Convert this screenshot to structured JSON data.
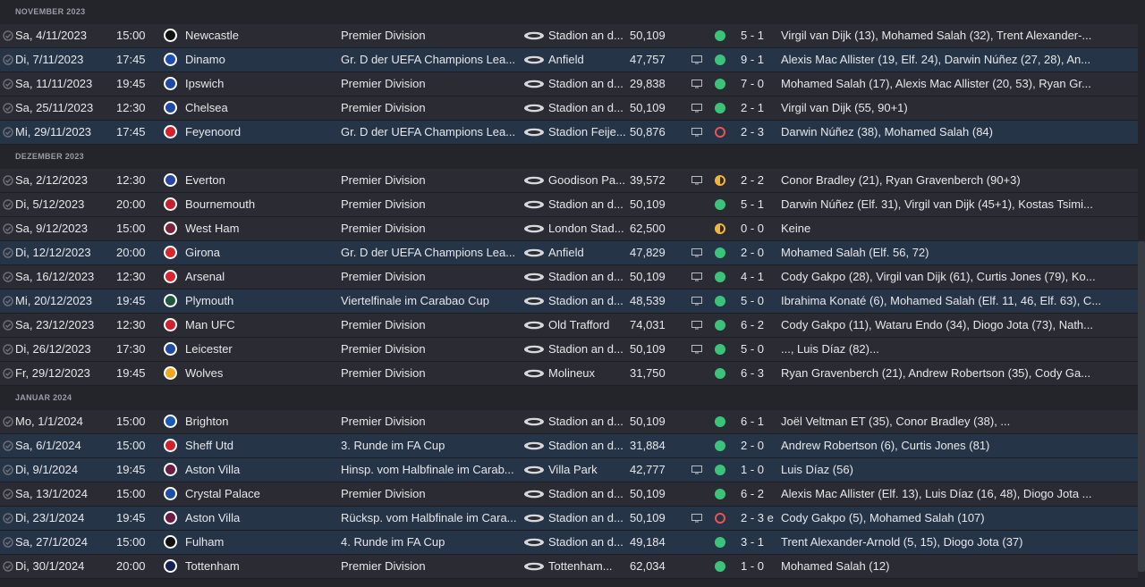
{
  "sections": [
    {
      "title": "NOVEMBER 2023",
      "matches": [
        {
          "date": "Sa, 4/11/2023",
          "time": "15:00",
          "opponent": "Newcastle",
          "crest": "newcastle-crest-icon",
          "crest_color": "#111111",
          "competition": "Premier Division",
          "stadium": "Stadion an d...",
          "attendance": "50,109",
          "tv": false,
          "result": "win",
          "score": "5 - 1",
          "scorers": "Virgil van Dijk (13), Mohamed Salah (32), Trent Alexander-...",
          "euro": false
        },
        {
          "date": "Di, 7/11/2023",
          "time": "17:45",
          "opponent": "Dinamo",
          "crest": "dinamo-crest-icon",
          "crest_color": "#1b4fb5",
          "competition": "Gr. D der UEFA Champions Lea...",
          "stadium": "Anfield",
          "attendance": "47,757",
          "tv": true,
          "result": "win",
          "score": "9 - 1",
          "scorers": "Alexis Mac Allister (19, Elf. 24), Darwin Núñez (27, 28), An...",
          "euro": true
        },
        {
          "date": "Sa, 11/11/2023",
          "time": "19:45",
          "opponent": "Ipswich",
          "crest": "ipswich-crest-icon",
          "crest_color": "#1c4aa6",
          "competition": "Premier Division",
          "stadium": "Stadion an d...",
          "attendance": "29,838",
          "tv": true,
          "result": "win",
          "score": "7 - 0",
          "scorers": "Mohamed Salah (17), Alexis Mac Allister (20, 53), Ryan Gr...",
          "euro": false
        },
        {
          "date": "Sa, 25/11/2023",
          "time": "12:30",
          "opponent": "Chelsea",
          "crest": "chelsea-crest-icon",
          "crest_color": "#1f4aa8",
          "competition": "Premier Division",
          "stadium": "Stadion an d...",
          "attendance": "50,109",
          "tv": true,
          "result": "win",
          "score": "2 - 1",
          "scorers": "Virgil van Dijk (55, 90+1)",
          "euro": false
        },
        {
          "date": "Mi, 29/11/2023",
          "time": "17:45",
          "opponent": "Feyenoord",
          "crest": "feyenoord-crest-icon",
          "crest_color": "#d6202a",
          "competition": "Gr. D der UEFA Champions Lea...",
          "stadium": "Stadion Feije...",
          "attendance": "50,876",
          "tv": true,
          "result": "loss",
          "score": "2 - 3",
          "scorers": "Darwin Núñez (38), Mohamed Salah (84)",
          "euro": true
        }
      ]
    },
    {
      "title": "DEZEMBER 2023",
      "matches": [
        {
          "date": "Sa, 2/12/2023",
          "time": "12:30",
          "opponent": "Everton",
          "crest": "everton-crest-icon",
          "crest_color": "#2746a8",
          "competition": "Premier Division",
          "stadium": "Goodison Pa...",
          "attendance": "39,572",
          "tv": true,
          "result": "draw",
          "score": "2 - 2",
          "scorers": "Conor Bradley (21), Ryan Gravenberch (90+3)",
          "euro": false
        },
        {
          "date": "Di, 5/12/2023",
          "time": "20:00",
          "opponent": "Bournemouth",
          "crest": "bournemouth-crest-icon",
          "crest_color": "#c8202c",
          "competition": "Premier Division",
          "stadium": "Stadion an d...",
          "attendance": "50,109",
          "tv": false,
          "result": "win",
          "score": "5 - 1",
          "scorers": "Darwin Núñez (Elf. 31), Virgil van Dijk (45+1), Kostas Tsimi...",
          "euro": false
        },
        {
          "date": "Sa, 9/12/2023",
          "time": "15:00",
          "opponent": "West Ham",
          "crest": "westham-crest-icon",
          "crest_color": "#7a263a",
          "competition": "Premier Division",
          "stadium": "London Stad...",
          "attendance": "62,500",
          "tv": false,
          "result": "draw",
          "score": "0 - 0",
          "scorers": "Keine",
          "euro": false
        },
        {
          "date": "Di, 12/12/2023",
          "time": "20:00",
          "opponent": "Girona",
          "crest": "girona-crest-icon",
          "crest_color": "#d42a2a",
          "competition": "Gr. D der UEFA Champions Lea...",
          "stadium": "Anfield",
          "attendance": "47,829",
          "tv": true,
          "result": "win",
          "score": "2 - 0",
          "scorers": "Mohamed Salah (Elf. 56, 72)",
          "euro": true
        },
        {
          "date": "Sa, 16/12/2023",
          "time": "12:30",
          "opponent": "Arsenal",
          "crest": "arsenal-crest-icon",
          "crest_color": "#d8262c",
          "competition": "Premier Division",
          "stadium": "Stadion an d...",
          "attendance": "50,109",
          "tv": true,
          "result": "win",
          "score": "4 - 1",
          "scorers": "Cody Gakpo (28), Virgil van Dijk (61), Curtis Jones (79), Ko...",
          "euro": false
        },
        {
          "date": "Mi, 20/12/2023",
          "time": "19:45",
          "opponent": "Plymouth",
          "crest": "plymouth-crest-icon",
          "crest_color": "#1e5b3e",
          "competition": "Viertelfinale im Carabao Cup",
          "stadium": "Stadion an d...",
          "attendance": "48,539",
          "tv": true,
          "result": "win",
          "score": "5 - 0",
          "scorers": "Ibrahima Konaté (6), Mohamed Salah (Elf. 11, 46, Elf. 63), C...",
          "euro": true
        },
        {
          "date": "Sa, 23/12/2023",
          "time": "12:30",
          "opponent": "Man UFC",
          "crest": "manutd-crest-icon",
          "crest_color": "#d4202a",
          "competition": "Premier Division",
          "stadium": "Old Trafford",
          "attendance": "74,031",
          "tv": true,
          "result": "win",
          "score": "6 - 2",
          "scorers": "Cody Gakpo (11), Wataru Endo (34), Diogo Jota (73), Nath...",
          "euro": false
        },
        {
          "date": "Di, 26/12/2023",
          "time": "17:30",
          "opponent": "Leicester",
          "crest": "leicester-crest-icon",
          "crest_color": "#1f4ba4",
          "competition": "Premier Division",
          "stadium": "Stadion an d...",
          "attendance": "50,109",
          "tv": true,
          "result": "win",
          "score": "5 - 0",
          "scorers": "..., Luis Díaz (82)...",
          "euro": false
        },
        {
          "date": "Fr, 29/12/2023",
          "time": "19:45",
          "opponent": "Wolves",
          "crest": "wolves-crest-icon",
          "crest_color": "#f2a81c",
          "competition": "Premier Division",
          "stadium": "Molineux",
          "attendance": "31,750",
          "tv": false,
          "result": "win",
          "score": "6 - 3",
          "scorers": "Ryan Gravenberch (21), Andrew Robertson (35), Cody Ga...",
          "euro": false
        }
      ]
    },
    {
      "title": "JANUAR 2024",
      "matches": [
        {
          "date": "Mo, 1/1/2024",
          "time": "15:00",
          "opponent": "Brighton",
          "crest": "brighton-crest-icon",
          "crest_color": "#1a5bb5",
          "competition": "Premier Division",
          "stadium": "Stadion an d...",
          "attendance": "50,109",
          "tv": false,
          "result": "win",
          "score": "6 - 1",
          "scorers": "Joël Veltman ET (35), Conor Bradley (38), ...",
          "euro": false
        },
        {
          "date": "Sa, 6/1/2024",
          "time": "15:00",
          "opponent": "Sheff Utd",
          "crest": "sheffutd-crest-icon",
          "crest_color": "#d4202a",
          "competition": "3. Runde im FA Cup",
          "stadium": "Stadion an d...",
          "attendance": "31,884",
          "tv": false,
          "result": "win",
          "score": "2 - 0",
          "scorers": "Andrew Robertson (6), Curtis Jones (81)",
          "euro": true
        },
        {
          "date": "Di, 9/1/2024",
          "time": "19:45",
          "opponent": "Aston Villa",
          "crest": "astonvilla-crest-icon",
          "crest_color": "#6b1d45",
          "competition": "Hinsp. vom Halbfinale im Carab...",
          "stadium": "Villa Park",
          "attendance": "42,777",
          "tv": true,
          "result": "win",
          "score": "1 - 0",
          "scorers": "Luis Díaz (56)",
          "euro": true
        },
        {
          "date": "Sa, 13/1/2024",
          "time": "15:00",
          "opponent": "Crystal Palace",
          "crest": "crystalpalace-crest-icon",
          "crest_color": "#1b4fa8",
          "competition": "Premier Division",
          "stadium": "Stadion an d...",
          "attendance": "50,109",
          "tv": false,
          "result": "win",
          "score": "6 - 2",
          "scorers": "Alexis Mac Allister (Elf. 13), Luis Díaz (16, 48), Diogo Jota ...",
          "euro": false
        },
        {
          "date": "Di, 23/1/2024",
          "time": "19:45",
          "opponent": "Aston Villa",
          "crest": "astonvilla-crest-icon",
          "crest_color": "#6b1d45",
          "competition": "Rücksp. vom Halbfinale im Cara...",
          "stadium": "Stadion an d...",
          "attendance": "50,109",
          "tv": true,
          "result": "loss",
          "score": "2 - 3 e",
          "scorers": "Cody Gakpo (5), Mohamed Salah (107)",
          "euro": true
        },
        {
          "date": "Sa, 27/1/2024",
          "time": "15:00",
          "opponent": "Fulham",
          "crest": "fulham-crest-icon",
          "crest_color": "#111111",
          "competition": "4. Runde im FA Cup",
          "stadium": "Stadion an d...",
          "attendance": "49,184",
          "tv": false,
          "result": "win",
          "score": "3 - 1",
          "scorers": "Trent Alexander-Arnold (5, 15), Diogo Jota (37)",
          "euro": true
        },
        {
          "date": "Di, 30/1/2024",
          "time": "20:00",
          "opponent": "Tottenham",
          "crest": "tottenham-crest-icon",
          "crest_color": "#132257",
          "competition": "Premier Division",
          "stadium": "Tottenham...",
          "attendance": "62,034",
          "tv": false,
          "result": "win",
          "score": "1 - 0",
          "scorers": "Mohamed Salah (12)",
          "euro": false
        }
      ]
    }
  ]
}
